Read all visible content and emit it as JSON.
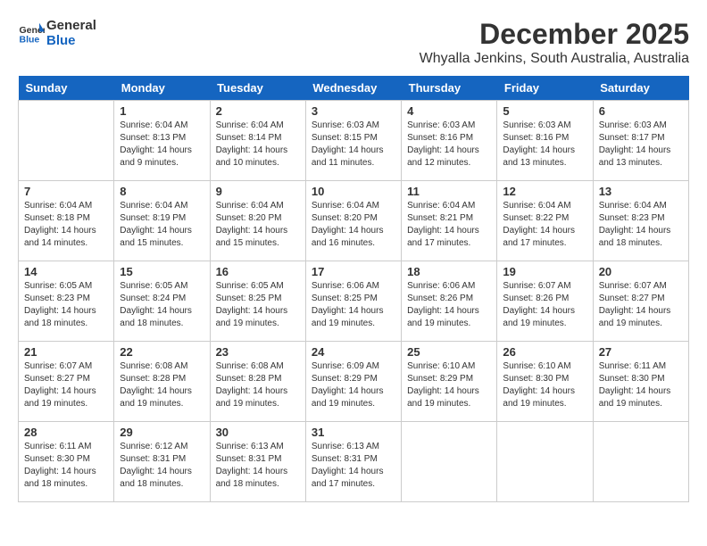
{
  "header": {
    "logo_line1": "General",
    "logo_line2": "Blue",
    "month": "December 2025",
    "location": "Whyalla Jenkins, South Australia, Australia"
  },
  "days_of_week": [
    "Sunday",
    "Monday",
    "Tuesday",
    "Wednesday",
    "Thursday",
    "Friday",
    "Saturday"
  ],
  "weeks": [
    [
      {
        "day": "",
        "sunrise": "",
        "sunset": "",
        "daylight": ""
      },
      {
        "day": "1",
        "sunrise": "Sunrise: 6:04 AM",
        "sunset": "Sunset: 8:13 PM",
        "daylight": "Daylight: 14 hours and 9 minutes."
      },
      {
        "day": "2",
        "sunrise": "Sunrise: 6:04 AM",
        "sunset": "Sunset: 8:14 PM",
        "daylight": "Daylight: 14 hours and 10 minutes."
      },
      {
        "day": "3",
        "sunrise": "Sunrise: 6:03 AM",
        "sunset": "Sunset: 8:15 PM",
        "daylight": "Daylight: 14 hours and 11 minutes."
      },
      {
        "day": "4",
        "sunrise": "Sunrise: 6:03 AM",
        "sunset": "Sunset: 8:16 PM",
        "daylight": "Daylight: 14 hours and 12 minutes."
      },
      {
        "day": "5",
        "sunrise": "Sunrise: 6:03 AM",
        "sunset": "Sunset: 8:16 PM",
        "daylight": "Daylight: 14 hours and 13 minutes."
      },
      {
        "day": "6",
        "sunrise": "Sunrise: 6:03 AM",
        "sunset": "Sunset: 8:17 PM",
        "daylight": "Daylight: 14 hours and 13 minutes."
      }
    ],
    [
      {
        "day": "7",
        "sunrise": "Sunrise: 6:04 AM",
        "sunset": "Sunset: 8:18 PM",
        "daylight": "Daylight: 14 hours and 14 minutes."
      },
      {
        "day": "8",
        "sunrise": "Sunrise: 6:04 AM",
        "sunset": "Sunset: 8:19 PM",
        "daylight": "Daylight: 14 hours and 15 minutes."
      },
      {
        "day": "9",
        "sunrise": "Sunrise: 6:04 AM",
        "sunset": "Sunset: 8:20 PM",
        "daylight": "Daylight: 14 hours and 15 minutes."
      },
      {
        "day": "10",
        "sunrise": "Sunrise: 6:04 AM",
        "sunset": "Sunset: 8:20 PM",
        "daylight": "Daylight: 14 hours and 16 minutes."
      },
      {
        "day": "11",
        "sunrise": "Sunrise: 6:04 AM",
        "sunset": "Sunset: 8:21 PM",
        "daylight": "Daylight: 14 hours and 17 minutes."
      },
      {
        "day": "12",
        "sunrise": "Sunrise: 6:04 AM",
        "sunset": "Sunset: 8:22 PM",
        "daylight": "Daylight: 14 hours and 17 minutes."
      },
      {
        "day": "13",
        "sunrise": "Sunrise: 6:04 AM",
        "sunset": "Sunset: 8:23 PM",
        "daylight": "Daylight: 14 hours and 18 minutes."
      }
    ],
    [
      {
        "day": "14",
        "sunrise": "Sunrise: 6:05 AM",
        "sunset": "Sunset: 8:23 PM",
        "daylight": "Daylight: 14 hours and 18 minutes."
      },
      {
        "day": "15",
        "sunrise": "Sunrise: 6:05 AM",
        "sunset": "Sunset: 8:24 PM",
        "daylight": "Daylight: 14 hours and 18 minutes."
      },
      {
        "day": "16",
        "sunrise": "Sunrise: 6:05 AM",
        "sunset": "Sunset: 8:25 PM",
        "daylight": "Daylight: 14 hours and 19 minutes."
      },
      {
        "day": "17",
        "sunrise": "Sunrise: 6:06 AM",
        "sunset": "Sunset: 8:25 PM",
        "daylight": "Daylight: 14 hours and 19 minutes."
      },
      {
        "day": "18",
        "sunrise": "Sunrise: 6:06 AM",
        "sunset": "Sunset: 8:26 PM",
        "daylight": "Daylight: 14 hours and 19 minutes."
      },
      {
        "day": "19",
        "sunrise": "Sunrise: 6:07 AM",
        "sunset": "Sunset: 8:26 PM",
        "daylight": "Daylight: 14 hours and 19 minutes."
      },
      {
        "day": "20",
        "sunrise": "Sunrise: 6:07 AM",
        "sunset": "Sunset: 8:27 PM",
        "daylight": "Daylight: 14 hours and 19 minutes."
      }
    ],
    [
      {
        "day": "21",
        "sunrise": "Sunrise: 6:07 AM",
        "sunset": "Sunset: 8:27 PM",
        "daylight": "Daylight: 14 hours and 19 minutes."
      },
      {
        "day": "22",
        "sunrise": "Sunrise: 6:08 AM",
        "sunset": "Sunset: 8:28 PM",
        "daylight": "Daylight: 14 hours and 19 minutes."
      },
      {
        "day": "23",
        "sunrise": "Sunrise: 6:08 AM",
        "sunset": "Sunset: 8:28 PM",
        "daylight": "Daylight: 14 hours and 19 minutes."
      },
      {
        "day": "24",
        "sunrise": "Sunrise: 6:09 AM",
        "sunset": "Sunset: 8:29 PM",
        "daylight": "Daylight: 14 hours and 19 minutes."
      },
      {
        "day": "25",
        "sunrise": "Sunrise: 6:10 AM",
        "sunset": "Sunset: 8:29 PM",
        "daylight": "Daylight: 14 hours and 19 minutes."
      },
      {
        "day": "26",
        "sunrise": "Sunrise: 6:10 AM",
        "sunset": "Sunset: 8:30 PM",
        "daylight": "Daylight: 14 hours and 19 minutes."
      },
      {
        "day": "27",
        "sunrise": "Sunrise: 6:11 AM",
        "sunset": "Sunset: 8:30 PM",
        "daylight": "Daylight: 14 hours and 19 minutes."
      }
    ],
    [
      {
        "day": "28",
        "sunrise": "Sunrise: 6:11 AM",
        "sunset": "Sunset: 8:30 PM",
        "daylight": "Daylight: 14 hours and 18 minutes."
      },
      {
        "day": "29",
        "sunrise": "Sunrise: 6:12 AM",
        "sunset": "Sunset: 8:31 PM",
        "daylight": "Daylight: 14 hours and 18 minutes."
      },
      {
        "day": "30",
        "sunrise": "Sunrise: 6:13 AM",
        "sunset": "Sunset: 8:31 PM",
        "daylight": "Daylight: 14 hours and 18 minutes."
      },
      {
        "day": "31",
        "sunrise": "Sunrise: 6:13 AM",
        "sunset": "Sunset: 8:31 PM",
        "daylight": "Daylight: 14 hours and 17 minutes."
      },
      {
        "day": "",
        "sunrise": "",
        "sunset": "",
        "daylight": ""
      },
      {
        "day": "",
        "sunrise": "",
        "sunset": "",
        "daylight": ""
      },
      {
        "day": "",
        "sunrise": "",
        "sunset": "",
        "daylight": ""
      }
    ]
  ]
}
